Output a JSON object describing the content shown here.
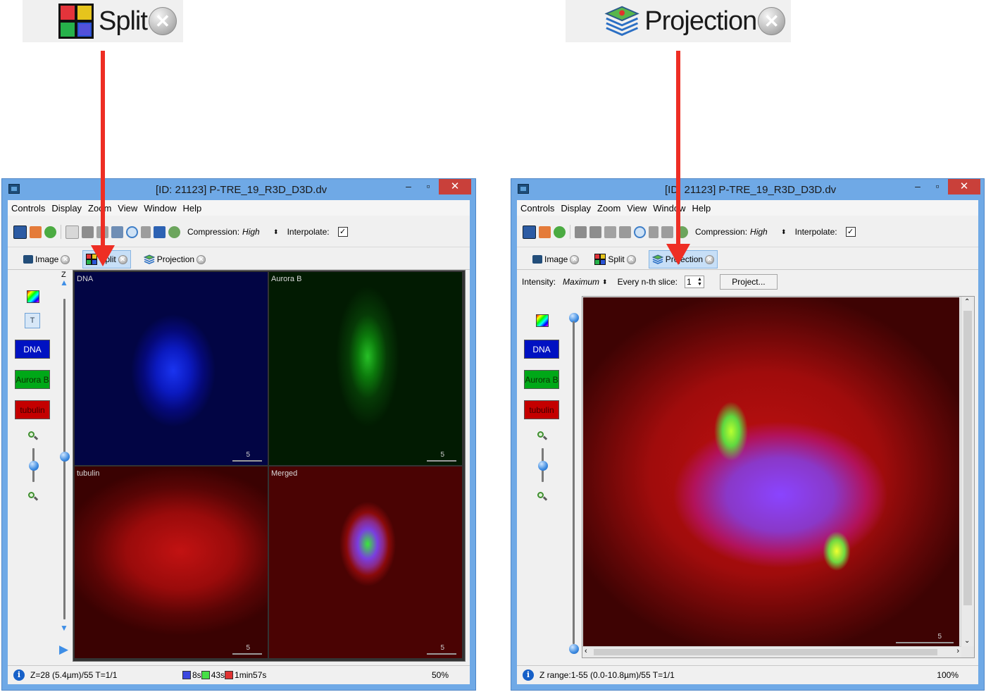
{
  "callouts": {
    "split_label": "Split",
    "projection_label": "Projection"
  },
  "left_window": {
    "title": "[ID: 21123] P-TRE_19_R3D_D3D.dv",
    "menu": [
      "Controls",
      "Display",
      "Zoom",
      "View",
      "Window",
      "Help"
    ],
    "compression_label": "Compression:",
    "compression_value": "High",
    "interpolate_label": "Interpolate:",
    "tabs": [
      "Image",
      "Split",
      "Projection"
    ],
    "z_label": "Z",
    "channels": [
      "DNA",
      "Aurora B",
      "tubulin"
    ],
    "panels": [
      {
        "label": "DNA",
        "scale": "5"
      },
      {
        "label": "Aurora B",
        "scale": "5"
      },
      {
        "label": "tubulin",
        "scale": "5"
      },
      {
        "label": "Merged",
        "scale": "5"
      }
    ],
    "status": {
      "position": "Z=28 (5.4µm)/55 T=1/1",
      "exposures": [
        "8s",
        "43s",
        "1min57s"
      ],
      "zoom": "50%"
    }
  },
  "right_window": {
    "title": "[ID: 21123] P-TRE_19_R3D_D3D.dv",
    "menu": [
      "Controls",
      "Display",
      "Zoom",
      "View",
      "Window",
      "Help"
    ],
    "compression_label": "Compression:",
    "compression_value": "High",
    "interpolate_label": "Interpolate:",
    "tabs": [
      "Image",
      "Split",
      "Projection"
    ],
    "intensity_label": "Intensity:",
    "intensity_value": "Maximum",
    "nth_label": "Every n-th slice:",
    "nth_value": "1",
    "project_button": "Project...",
    "channels": [
      "DNA",
      "Aurora B",
      "tubulin"
    ],
    "scale": "5",
    "status": {
      "range": "Z range:1-55 (0.0-10.8µm)/55 T=1/1",
      "zoom": "100%"
    }
  },
  "colors": {
    "dna": "#0012c2",
    "aurora_b": "#00a818",
    "tubulin": "#c40000",
    "arrow": "#ee2e24",
    "window_frame": "#6fa9e6",
    "close_button": "#c9403a"
  }
}
